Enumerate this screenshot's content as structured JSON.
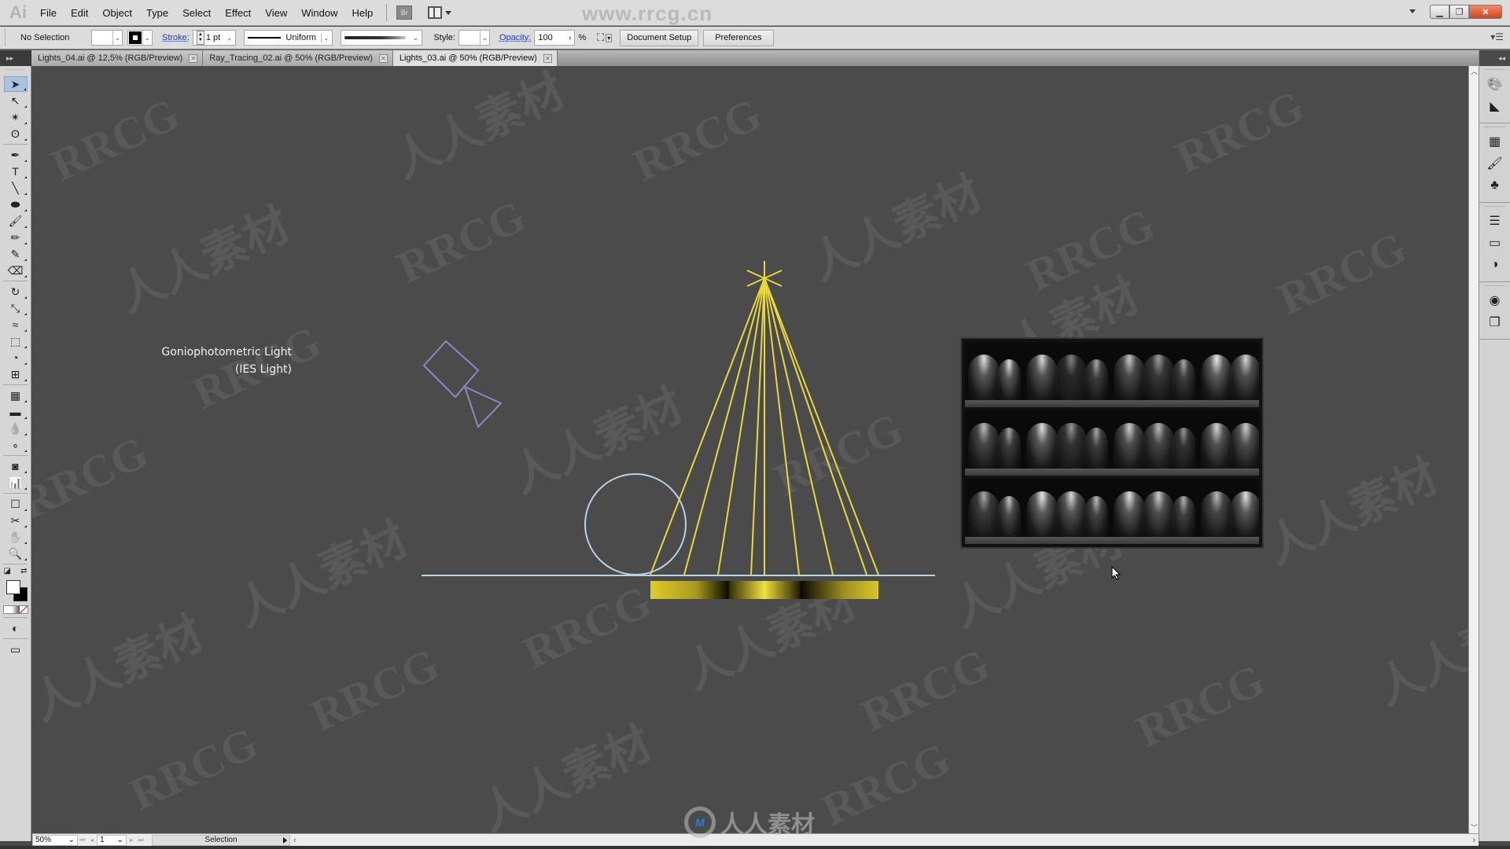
{
  "app": {
    "logo": "Ai",
    "watermark_url": "www.rrcg.cn",
    "watermark_text": "RRCG",
    "watermark_cn": "人人素材"
  },
  "menu": {
    "items": [
      "File",
      "Edit",
      "Object",
      "Type",
      "Select",
      "Effect",
      "View",
      "Window",
      "Help"
    ],
    "bridge_label": "Br"
  },
  "control_bar": {
    "selection_status": "No Selection",
    "stroke_label": "Stroke:",
    "stroke_weight": "1 pt",
    "stroke_profile": "Uniform",
    "style_label": "Style:",
    "opacity_label": "Opacity:",
    "opacity_value": "100",
    "opacity_unit": "%",
    "document_setup_label": "Document Setup",
    "preferences_label": "Preferences"
  },
  "tabs": [
    {
      "label": "Lights_04.ai @ 12,5% (RGB/Preview)",
      "active": false
    },
    {
      "label": "Ray_Tracing_02.ai @ 50% (RGB/Preview)",
      "active": false
    },
    {
      "label": "Lights_03.ai @ 50% (RGB/Preview)",
      "active": true
    }
  ],
  "tools": [
    {
      "name": "selection-tool",
      "glyph": "➤",
      "selected": true
    },
    {
      "name": "direct-selection-tool",
      "glyph": "↖"
    },
    {
      "name": "magic-wand-tool",
      "glyph": "✴"
    },
    {
      "name": "lasso-tool",
      "glyph": "ʘ"
    },
    {
      "sep": true
    },
    {
      "name": "pen-tool",
      "glyph": "✒"
    },
    {
      "name": "type-tool",
      "glyph": "T"
    },
    {
      "name": "line-segment-tool",
      "glyph": "╲"
    },
    {
      "name": "ellipse-tool",
      "glyph": "⬬"
    },
    {
      "name": "paintbrush-tool",
      "glyph": "🖌"
    },
    {
      "name": "pencil-tool",
      "glyph": "✏"
    },
    {
      "name": "blob-brush-tool",
      "glyph": "✎"
    },
    {
      "name": "eraser-tool",
      "glyph": "⌫"
    },
    {
      "sep": true
    },
    {
      "name": "rotate-tool",
      "glyph": "↻"
    },
    {
      "name": "scale-tool",
      "glyph": "⤡"
    },
    {
      "name": "width-tool",
      "glyph": "≈"
    },
    {
      "name": "free-transform-tool",
      "glyph": "⬚"
    },
    {
      "name": "shape-builder-tool",
      "glyph": "◔"
    },
    {
      "name": "perspective-grid-tool",
      "glyph": "⊞"
    },
    {
      "sep": true
    },
    {
      "name": "mesh-tool",
      "glyph": "▦"
    },
    {
      "name": "gradient-tool",
      "glyph": "▬"
    },
    {
      "name": "eyedropper-tool",
      "glyph": "💧"
    },
    {
      "name": "blend-tool",
      "glyph": "∘"
    },
    {
      "sep": true
    },
    {
      "name": "symbol-sprayer-tool",
      "glyph": "◙"
    },
    {
      "name": "column-graph-tool",
      "glyph": "📊"
    },
    {
      "sep": true
    },
    {
      "name": "artboard-tool",
      "glyph": "☐"
    },
    {
      "name": "slice-tool",
      "glyph": "✂"
    },
    {
      "name": "hand-tool",
      "glyph": "✋"
    },
    {
      "name": "zoom-tool",
      "glyph": "🔍"
    }
  ],
  "canvas": {
    "label_line1": "Goniophotometric Light",
    "label_line2": "(IES Light)"
  },
  "colors": {
    "light_rays": "#e8d83a",
    "sphere_floor": "#b9d4e6",
    "camera": "#8d87c2",
    "canvas_bg": "#4b4b4b"
  },
  "dock": {
    "icons": [
      [
        "color-palette-icon",
        "color-guide-icon"
      ],
      [
        "swatches-icon",
        "brushes-icon",
        "symbols-icon"
      ],
      [
        "stroke-icon",
        "gradient-icon",
        "transparency-icon"
      ],
      [
        "appearance-icon",
        "graphic-styles-icon"
      ]
    ]
  },
  "status_bar": {
    "zoom": "50%",
    "page": "1",
    "status": "Selection"
  }
}
